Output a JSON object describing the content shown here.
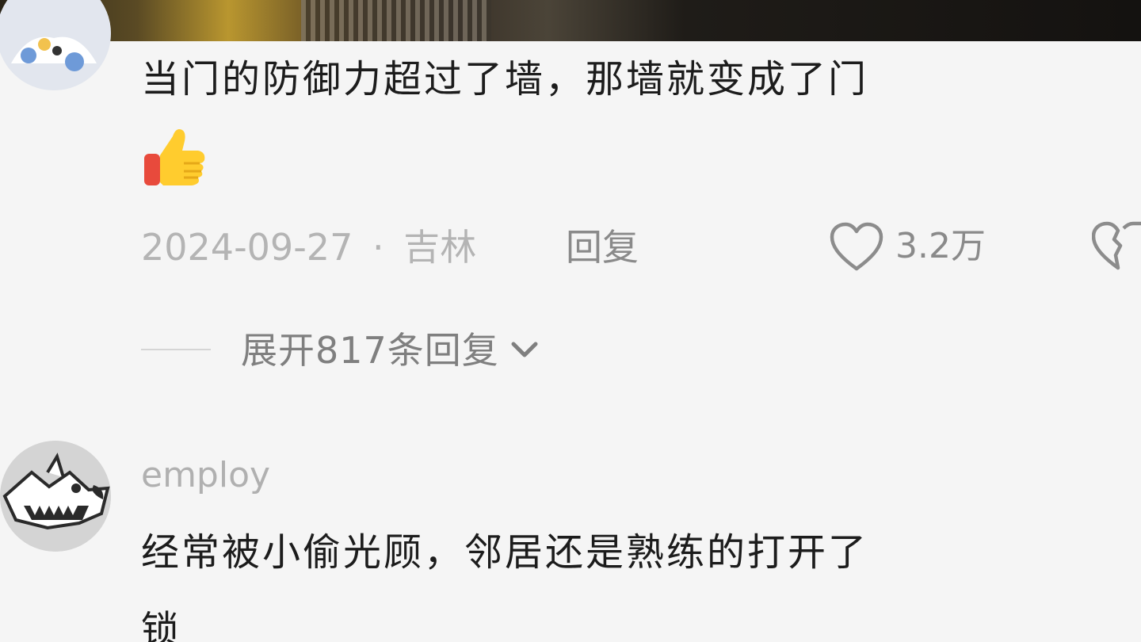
{
  "comments": [
    {
      "text": "当门的防御力超过了墙，那墙就变成了门",
      "emoji": "thumbs-up",
      "date": "2024-09-27",
      "separator": "·",
      "location": "吉林",
      "reply_label": "回复",
      "likes": "3.2万",
      "expand_label": "展开817条回复"
    },
    {
      "username": "employ",
      "text_line1": "经常被小偷光顾，邻居还是熟练的打开了",
      "text_line2": "锁"
    }
  ],
  "icons": {
    "like": "heart-icon",
    "dislike": "broken-heart-icon",
    "expand": "chevron-down-icon"
  }
}
